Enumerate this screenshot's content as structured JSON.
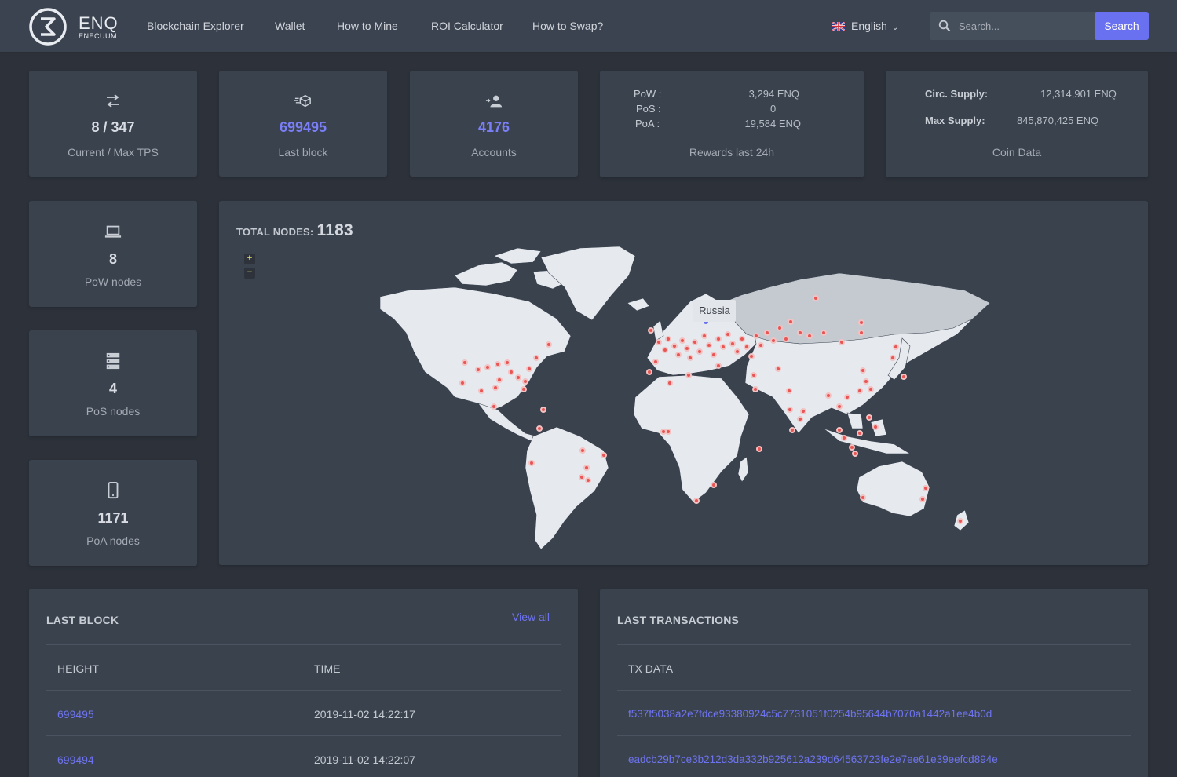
{
  "brand": {
    "wordmark": "ENQ",
    "sub": "ENECUUM"
  },
  "nav": {
    "items": [
      "Blockchain Explorer",
      "Wallet",
      "How to Mine",
      "ROI Calculator",
      "How to Swap?"
    ]
  },
  "language": {
    "label": "English",
    "flag_icon": "uk-flag-icon"
  },
  "search": {
    "placeholder": "Search...",
    "button_label": "Search"
  },
  "stats": {
    "tps": {
      "value": "8 / 347",
      "label": "Current / Max TPS",
      "icon": "transfer-icon"
    },
    "block": {
      "value": "699495",
      "label": "Last block",
      "icon": "cube-icon"
    },
    "accounts": {
      "value": "4176",
      "label": "Accounts",
      "icon": "user-icon"
    }
  },
  "rewards": {
    "pow_label": "PoW :",
    "pow_value": "3,294 ENQ",
    "pos_label": "PoS :",
    "pos_value": "0",
    "poa_label": "PoA :",
    "poa_value": "19,584 ENQ",
    "caption": "Rewards last 24h"
  },
  "coin": {
    "circ_label": "Circ. Supply:",
    "circ_value": "12,314,901 ENQ",
    "max_label": "Max Supply:",
    "max_value": "845,870,425 ENQ",
    "caption": "Coin Data"
  },
  "nodes": {
    "pow": {
      "value": "8",
      "label": "PoW nodes",
      "icon": "laptop-icon"
    },
    "pos": {
      "value": "4",
      "label": "PoS nodes",
      "icon": "server-icon"
    },
    "poa": {
      "value": "1171",
      "label": "PoA nodes",
      "icon": "phone-icon"
    }
  },
  "map": {
    "title_label": "TOTAL NODES:",
    "total": "1183",
    "zoom_in": "+",
    "zoom_out": "−",
    "tooltip": "Russia"
  },
  "last_block": {
    "title": "LAST BLOCK",
    "view_all": "View all",
    "columns": [
      "HEIGHT",
      "TIME"
    ],
    "rows": [
      {
        "height": "699495",
        "time": "2019-11-02 14:22:17"
      },
      {
        "height": "699494",
        "time": "2019-11-02 14:22:07"
      }
    ]
  },
  "last_tx": {
    "title": "LAST TRANSACTIONS",
    "columns": [
      "TX DATA"
    ],
    "rows": [
      "f537f5038a2e7fdce93380924c5c7731051f0254b95644b7070a1442a1ee4b0d",
      "eadcb29b7ce3b212d3da332b925612a239d64563723fe2e7ee61e39eefcd894e"
    ]
  },
  "colors": {
    "accent": "#6a71f1",
    "link": "#6e74f0",
    "background": "#2d323a",
    "card": "#3a424e",
    "node_dot": "#e85555"
  }
}
